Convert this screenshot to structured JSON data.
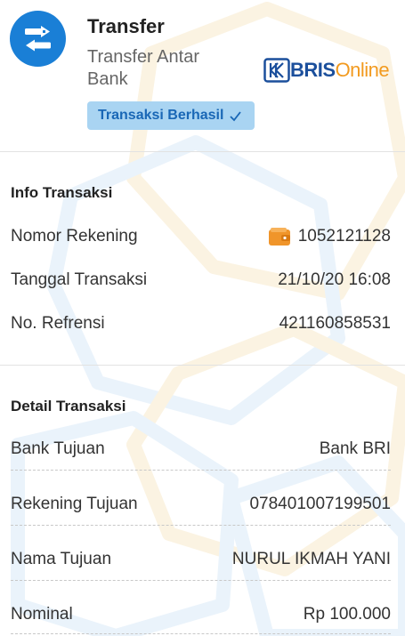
{
  "header": {
    "title": "Transfer",
    "subtitle": "Transfer Antar Bank",
    "logo_part1": "BRIS",
    "logo_part2": "Online",
    "status_badge": "Transaksi Berhasil"
  },
  "info": {
    "section_title": "Info Transaksi",
    "rows": [
      {
        "label": "Nomor Rekening",
        "value": "1052121128"
      },
      {
        "label": "Tanggal Transaksi",
        "value": "21/10/20 16:08"
      },
      {
        "label": "No. Refrensi",
        "value": "421160858531"
      }
    ]
  },
  "detail": {
    "section_title": "Detail Transaksi",
    "rows": [
      {
        "label": "Bank Tujuan",
        "value": "Bank BRI"
      },
      {
        "label": "Rekening Tujuan",
        "value": "078401007199501"
      },
      {
        "label": "Nama Tujuan",
        "value": "NURUL IKMAH YANI"
      },
      {
        "label": "Nominal",
        "value": "Rp 100.000"
      }
    ]
  },
  "colors": {
    "accent_blue": "#1a7fd6",
    "badge_bg": "#a9d4f2",
    "badge_text": "#1967b6",
    "logo_blue": "#1b4f9c",
    "logo_orange": "#f29a1f",
    "wallet_orange": "#f0952a"
  },
  "icons": {
    "app": "transfer-arrows-icon",
    "badge": "checkmark-icon",
    "account": "wallet-icon"
  }
}
